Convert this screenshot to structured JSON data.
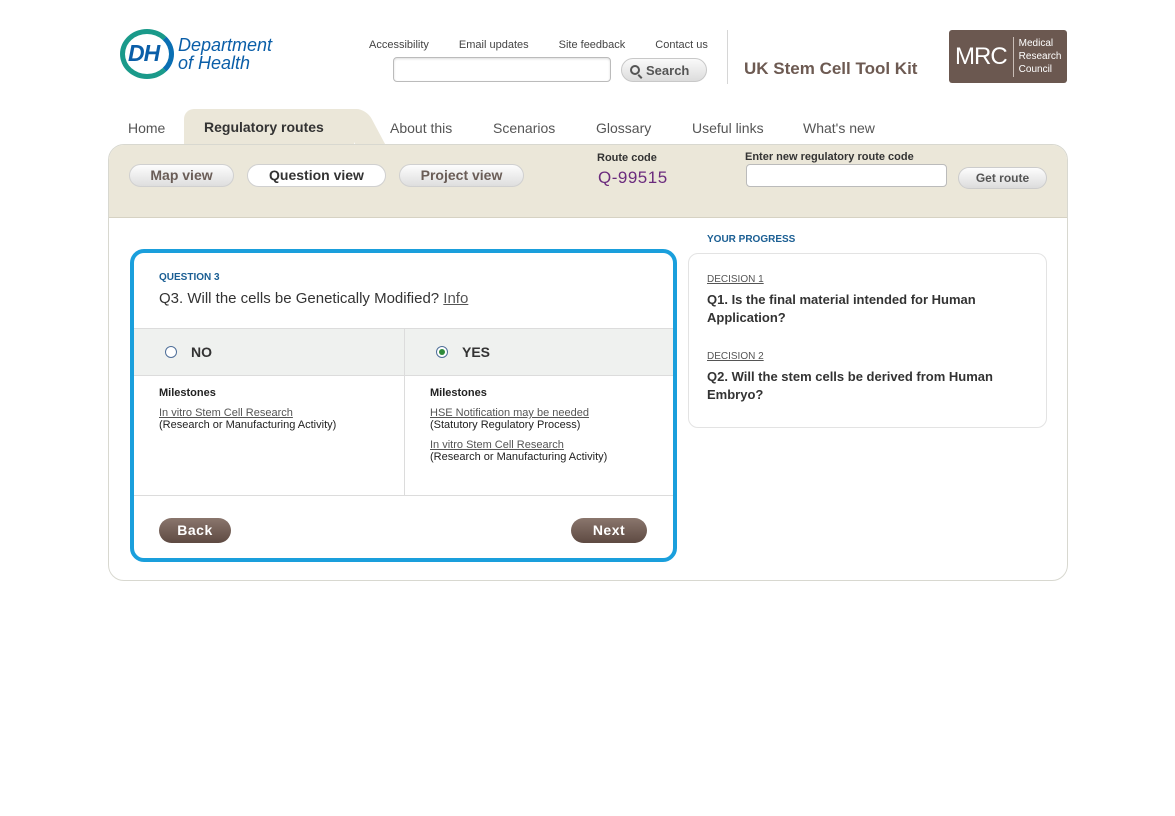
{
  "header": {
    "logo_line1": "Department",
    "logo_line2": "of Health",
    "logo_mark": "DH",
    "links": [
      "Accessibility",
      "Email updates",
      "Site feedback",
      "Contact us"
    ],
    "search_placeholder": "",
    "search_label": "Search",
    "toolkit_title": "UK Stem Cell Tool Kit",
    "mrc_abbr": "MRC",
    "mrc_line1": "Medical",
    "mrc_line2": "Research",
    "mrc_line3": "Council"
  },
  "tabs": [
    "Home",
    "Regulatory routes",
    "About this",
    "Scenarios",
    "Glossary",
    "Useful links",
    "What's new"
  ],
  "active_tab": "Regulatory routes",
  "views": {
    "map": "Map view",
    "question": "Question view",
    "project": "Project view",
    "active": "Question view"
  },
  "route": {
    "label": "Route code",
    "code": "Q-99515",
    "enter_label": "Enter new regulatory route code",
    "input_value": "",
    "button": "Get route"
  },
  "question": {
    "label": "QUESTION 3",
    "text": "Q3. Will the cells be Genetically Modified?",
    "info_link": "Info",
    "options": [
      {
        "label": "NO",
        "checked": false,
        "milestones_title": "Milestones",
        "milestones": [
          {
            "link": "In vitro Stem Cell Research",
            "sub": "(Research or Manufacturing Activity)"
          }
        ]
      },
      {
        "label": "YES",
        "checked": true,
        "milestones_title": "Milestones",
        "milestones": [
          {
            "link": "HSE Notification may be needed",
            "sub": "(Statutory Regulatory Process)"
          },
          {
            "link": "In vitro Stem Cell Research",
            "sub": "(Research or Manufacturing Activity)"
          }
        ]
      }
    ],
    "back": "Back",
    "next": "Next"
  },
  "progress": {
    "title": "YOUR PROGRESS",
    "decisions": [
      {
        "label": "DECISION 1",
        "question": "Q1. Is the final material intended for Human Application?"
      },
      {
        "label": "DECISION 2",
        "question": "Q2. Will the stem cells be derived from Human Embryo?"
      }
    ]
  },
  "colors": {
    "accent_blue": "#1a9fdc",
    "brand_brown": "#6b5850",
    "route_code_purple": "#6b2b7d",
    "panel_beige": "#ebe7d9"
  }
}
